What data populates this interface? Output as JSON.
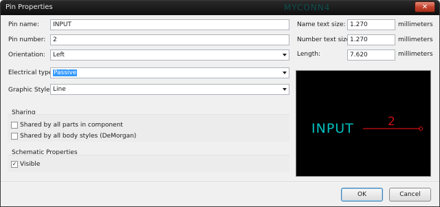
{
  "window": {
    "title": "Pin Properties",
    "background_title": "MYCONN4",
    "close_glyph": "✕"
  },
  "fields": {
    "pin_name": {
      "label": "Pin name:",
      "value": "INPUT"
    },
    "pin_number": {
      "label": "Pin number:",
      "value": "2"
    },
    "orientation": {
      "label": "Orientation:",
      "value": "Left"
    },
    "electrical_type": {
      "label": "Electrical type:",
      "value": "Passive"
    },
    "graphic_style": {
      "label": "Graphic Style:",
      "value": "Line"
    },
    "name_text_size": {
      "label": "Name text size:",
      "value": "1.270",
      "unit": "millimeters"
    },
    "number_text_size": {
      "label": "Number text size:",
      "value": "1.270",
      "unit": "millimeters"
    },
    "length": {
      "label": "Length:",
      "value": "7.620",
      "unit": "millimeters"
    }
  },
  "sharing": {
    "title": "Sharing",
    "options": [
      {
        "label": "Shared by all parts in component",
        "checked": false
      },
      {
        "label": "Shared by all body styles (DeMorgan)",
        "checked": false
      }
    ]
  },
  "schematic": {
    "title": "Schematic Properties",
    "visible": {
      "label": "Visible",
      "checked": true,
      "check_glyph": "✓"
    }
  },
  "preview": {
    "pin_name_text": "INPUT",
    "pin_number_text": "2",
    "name_color": "#00c0c0",
    "pin_color": "#cc1010"
  },
  "buttons": {
    "ok": "OK",
    "cancel": "Cancel"
  },
  "icons": {
    "close": "close-icon",
    "dropdown": "chevron-down-icon",
    "check": "checkmark-icon"
  }
}
